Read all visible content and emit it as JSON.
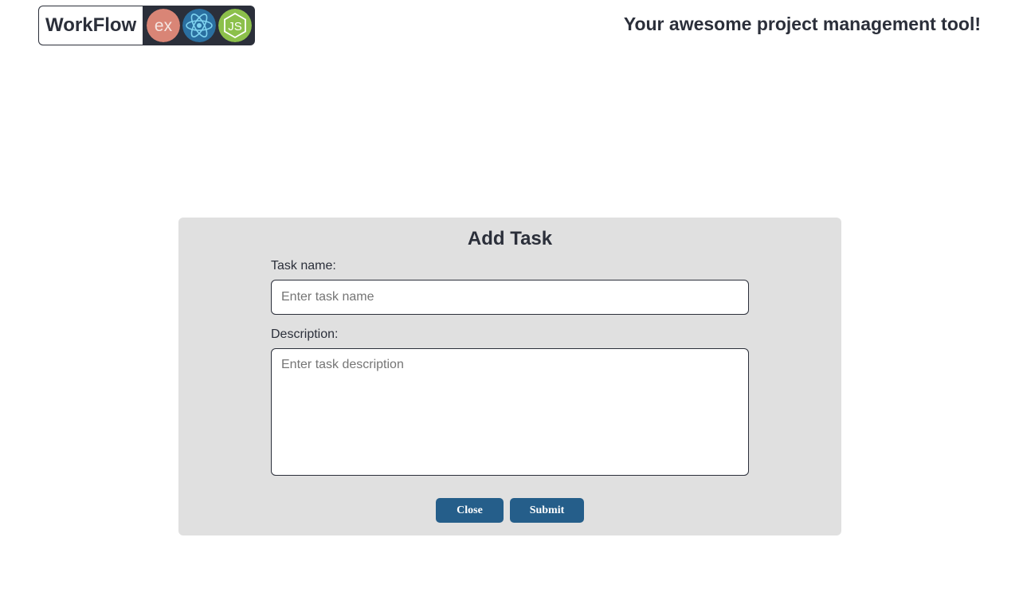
{
  "header": {
    "logo_text": "WorkFlow",
    "tagline": "Your awesome project management tool!",
    "tech_icons": [
      {
        "name": "express-icon",
        "label": "ex",
        "color": "#d98576"
      },
      {
        "name": "react-icon",
        "color": "#2a6fa0"
      },
      {
        "name": "nodejs-icon",
        "label": "JS",
        "color": "#8cc04b"
      }
    ]
  },
  "modal": {
    "title": "Add Task",
    "task_name_label": "Task name:",
    "task_name_placeholder": "Enter task name",
    "task_name_value": "",
    "description_label": "Description:",
    "description_placeholder": "Enter task description",
    "description_value": "",
    "close_label": "Close",
    "submit_label": "Submit"
  },
  "colors": {
    "primary_button": "#255e8a",
    "modal_background": "#e0e0e0",
    "text": "#2b2f3a"
  }
}
